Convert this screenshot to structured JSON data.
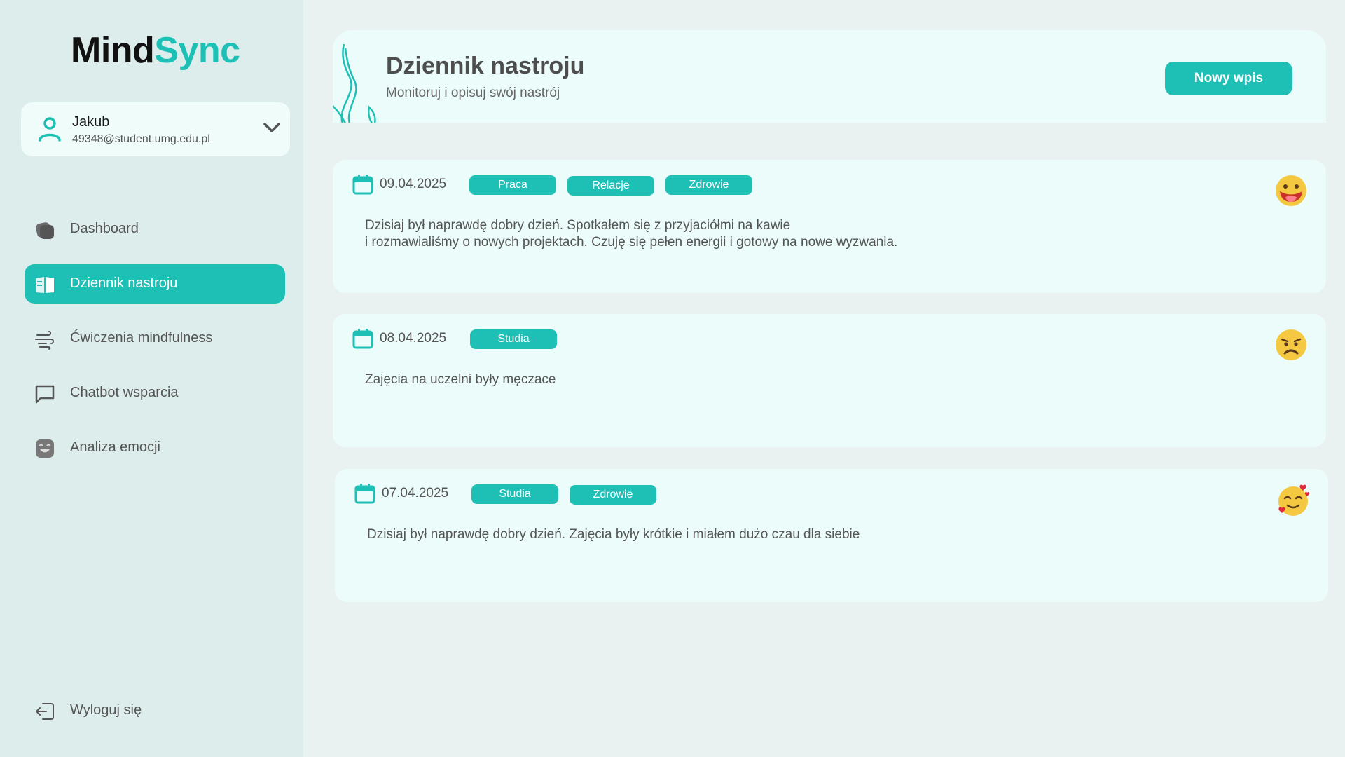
{
  "app": {
    "name_part1": "Mind",
    "name_part2": "Sync"
  },
  "user": {
    "name": "Jakub",
    "email": "49348@student.umg.edu.pl"
  },
  "nav": [
    {
      "label": "Dashboard",
      "icon": "dashboard-icon"
    },
    {
      "label": "Dziennik nastroju",
      "icon": "journal-icon",
      "active": true
    },
    {
      "label": "Ćwiczenia mindfulness",
      "icon": "wind-icon"
    },
    {
      "label": "Chatbot wsparcia",
      "icon": "chat-icon"
    },
    {
      "label": "Analiza emocji",
      "icon": "emotion-icon"
    }
  ],
  "logout": {
    "label": "Wyloguj się",
    "icon": "logout-icon"
  },
  "header": {
    "title": "Dziennik nastroju",
    "subtitle": "Monitoruj i opisuj swój nastrój",
    "new_entry_label": "Nowy wpis"
  },
  "entries": [
    {
      "date": "09.04.2025",
      "tags": [
        "Praca",
        "Relacje",
        "Zdrowie"
      ],
      "text": "Dzisiaj był naprawdę dobry dzień. Spotkałem się z przyjaciółmi na kawie\ni rozmawialiśmy o nowych projektach. Czuję się pełen energii i gotowy na nowe wyzwania.",
      "mood_icon": "happy-tongue-emoji-icon"
    },
    {
      "date": "08.04.2025",
      "tags": [
        "Studia"
      ],
      "text": "Zajęcia na uczelni były męczace",
      "mood_icon": "sad-frown-emoji-icon"
    },
    {
      "date": "07.04.2025",
      "tags": [
        "Studia",
        "Zdrowie"
      ],
      "text": "Dzisiaj był naprawdę dobry dzień. Zajęcia były krótkie i miałem dużo czau dla siebie",
      "mood_icon": "smiling-hearts-emoji-icon"
    }
  ],
  "colors": {
    "accent": "#1ec0b6",
    "sidebar_bg": "#dcedeb",
    "main_bg": "#e9f2f0",
    "card_bg": "#ebfcfa"
  }
}
